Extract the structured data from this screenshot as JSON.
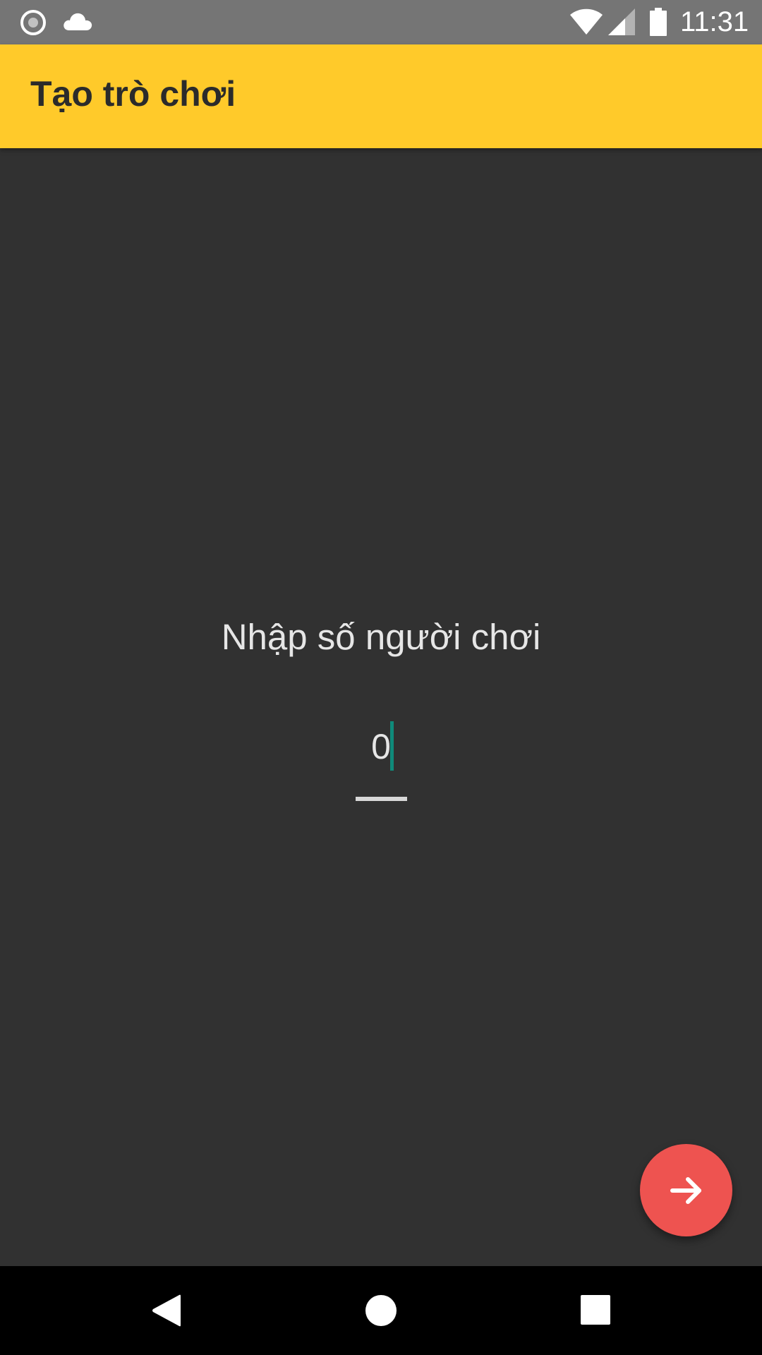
{
  "status_bar": {
    "time": "11:31",
    "icons": [
      "record-icon",
      "cloud-icon",
      "wifi-icon",
      "cell-signal-icon",
      "battery-icon"
    ]
  },
  "app_bar": {
    "title": "Tạo trò chơi",
    "color": "#ffca2a"
  },
  "main": {
    "prompt": "Nhập số người chơi",
    "player_count_value": "0",
    "background": "#313131",
    "accent_caret": "#0f8a7a"
  },
  "fab": {
    "icon": "arrow-right-icon",
    "color": "#ee5350"
  },
  "nav_bar": {
    "icons": [
      "back-icon",
      "home-icon",
      "recents-icon"
    ]
  }
}
